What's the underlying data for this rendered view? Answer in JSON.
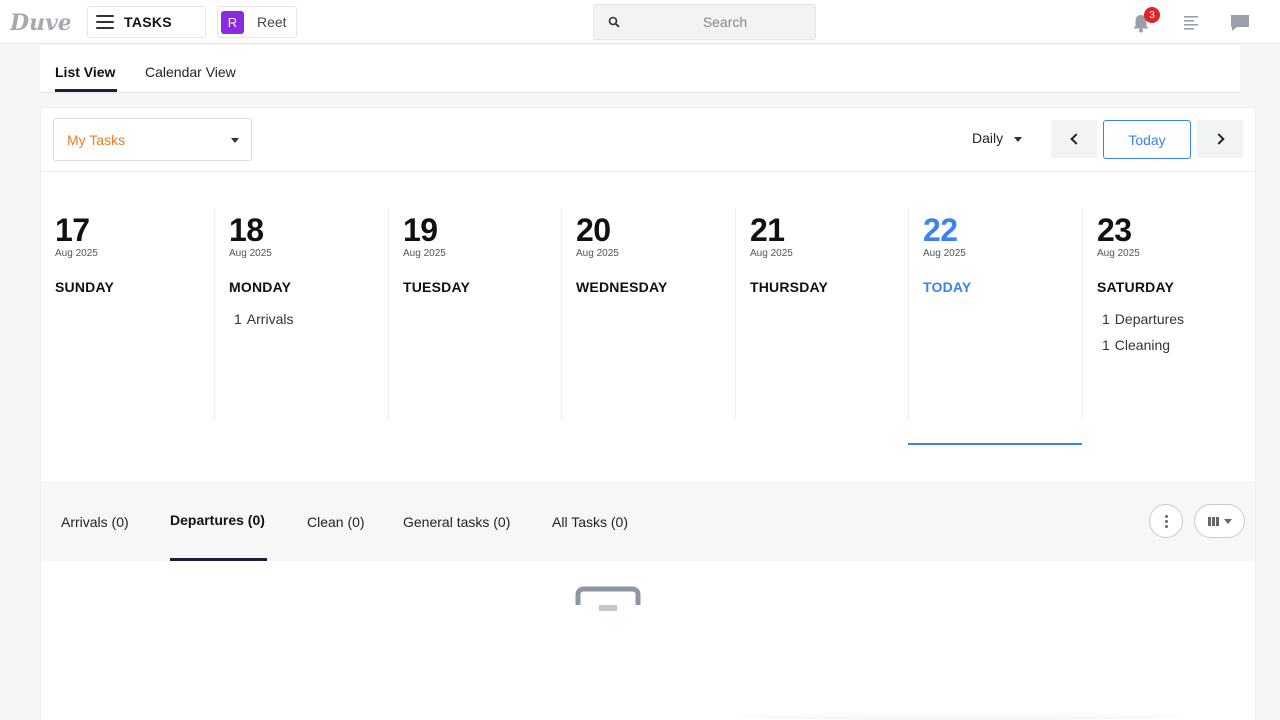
{
  "header": {
    "logo_text": "Duve",
    "menu_label": "TASKS",
    "user": {
      "initial": "R",
      "name": "Reet",
      "avatar_color": "#8a2be2"
    },
    "search_placeholder": "Search",
    "notification_count": "3"
  },
  "view_tabs": [
    {
      "label": "List View",
      "active": true
    },
    {
      "label": "Calendar View",
      "active": false
    }
  ],
  "toolbar": {
    "filter_value": "My Tasks",
    "period_value": "Daily",
    "today_label": "Today"
  },
  "days": [
    {
      "num": "17",
      "month": "Aug 2025",
      "name": "SUNDAY",
      "items": []
    },
    {
      "num": "18",
      "month": "Aug 2025",
      "name": "MONDAY",
      "items": [
        {
          "count": "1",
          "label": "Arrivals"
        }
      ]
    },
    {
      "num": "19",
      "month": "Aug 2025",
      "name": "TUESDAY",
      "items": []
    },
    {
      "num": "20",
      "month": "Aug 2025",
      "name": "WEDNESDAY",
      "items": []
    },
    {
      "num": "21",
      "month": "Aug 2025",
      "name": "THURSDAY",
      "items": []
    },
    {
      "num": "22",
      "month": "Aug 2025",
      "name": "TODAY",
      "items": [],
      "is_today": true
    },
    {
      "num": "23",
      "month": "Aug 2025",
      "name": "SATURDAY",
      "items": [
        {
          "count": "1",
          "label": "Departures"
        },
        {
          "count": "1",
          "label": "Cleaning"
        }
      ]
    }
  ],
  "task_tabs": [
    {
      "label": "Arrivals (0)",
      "active": false
    },
    {
      "label": "Departures (0)",
      "active": true
    },
    {
      "label": "Clean (0)",
      "active": false
    },
    {
      "label": "General tasks (0)",
      "active": false
    },
    {
      "label": "All Tasks (0)",
      "active": false
    }
  ],
  "colors": {
    "accent_blue": "#3b82f6",
    "filter_orange": "#e67e22",
    "active_tab_underline": "#1f1d3b",
    "badge_red": "#e02424"
  }
}
